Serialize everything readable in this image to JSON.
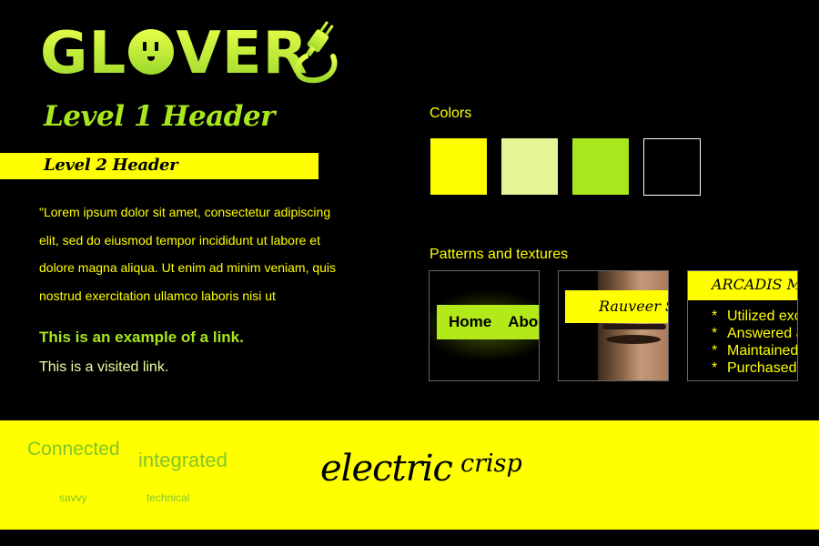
{
  "logo": {
    "text_before": "GL",
    "text_after": "VER"
  },
  "headers": {
    "level1": "Level 1 Header",
    "level2": "Level 2 Header"
  },
  "body": {
    "lorem": "\"Lorem ipsum dolor sit amet, consectetur adipiscing elit, sed do eiusmod tempor incididunt ut labore et dolore magna aliqua. Ut enim ad minim veniam, quis nostrud exercitation ullamco laboris nisi ut",
    "link": "This is an example of a link.",
    "visited": "This is a visited link."
  },
  "colors": {
    "title": "Colors",
    "swatches": [
      "#ffff00",
      "#e3f595",
      "#a8e61d",
      "#000000"
    ]
  },
  "patterns": {
    "title": "Patterns and textures",
    "tile0": {
      "items": [
        "Home",
        "Abo"
      ]
    },
    "tile1": {
      "label": "Rauveer S"
    },
    "tile2": {
      "header": "ARCADIS M",
      "items": [
        "Utilized exc",
        "Answered a",
        "Maintained",
        "Purchased"
      ]
    }
  },
  "words": {
    "connected": "Connected",
    "integrated": "integrated",
    "savvy": "savvy",
    "technical": "technical",
    "electric": "electric",
    "crisp": "crisp"
  }
}
